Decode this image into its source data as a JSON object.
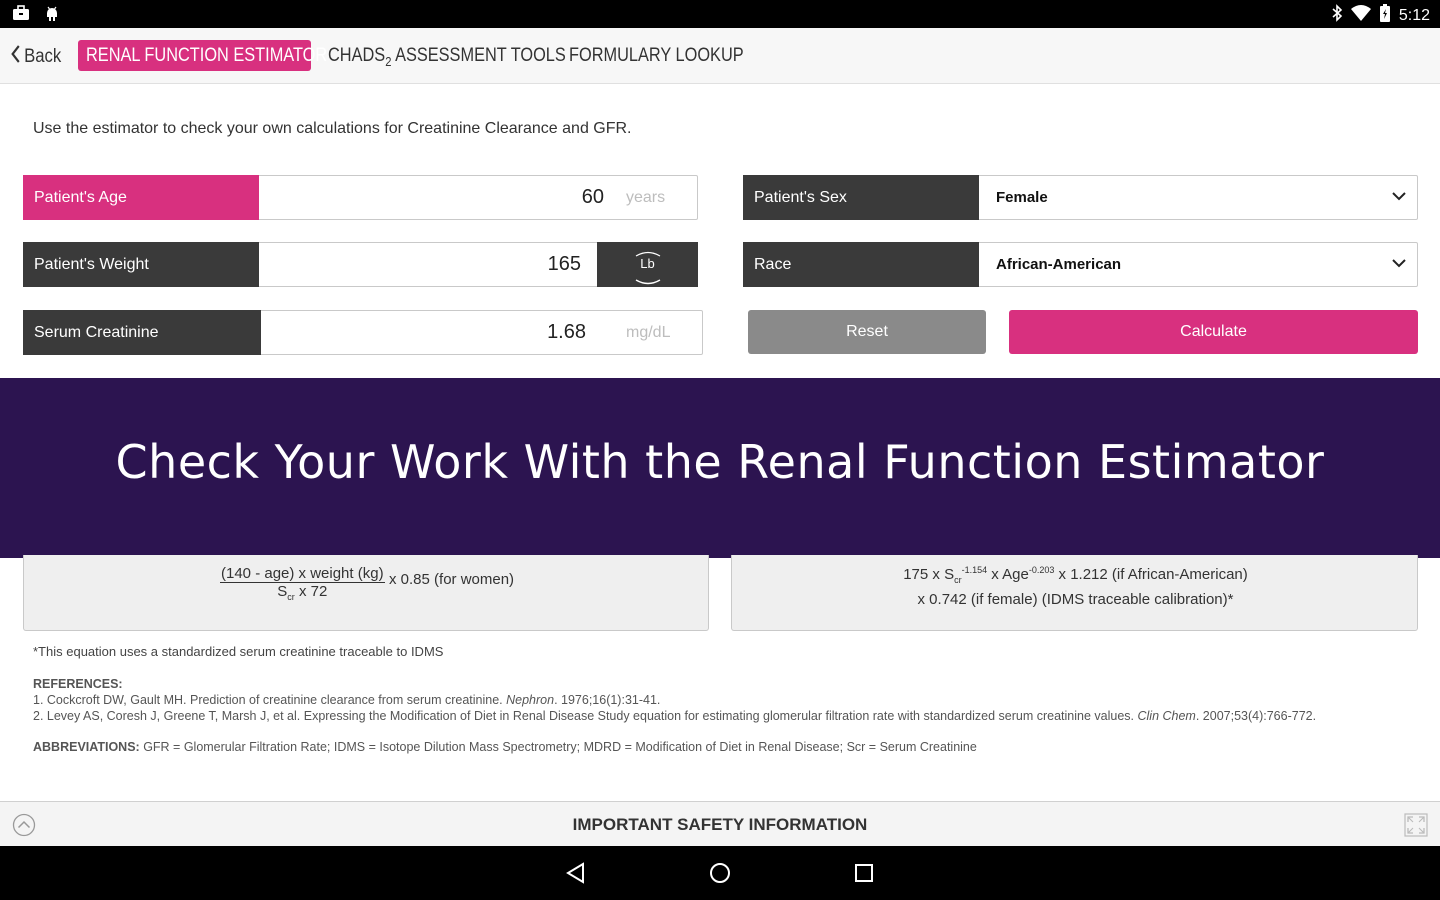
{
  "status_bar": {
    "time": "5:12",
    "left_icons": [
      "briefcase-icon",
      "android-icon"
    ],
    "right_icons": [
      "bluetooth-icon",
      "wifi-icon",
      "battery-icon"
    ]
  },
  "nav": {
    "back_label": "Back",
    "tabs": [
      {
        "label": "RENAL FUNCTION ESTIMATOR",
        "active": true
      },
      {
        "label": "CHADS",
        "subscript": "2",
        "label_rest": " ASSESSMENT TOOLS",
        "active": false
      },
      {
        "label": "FORMULARY LOOKUP",
        "active": false
      }
    ]
  },
  "intro": "Use the estimator to check your own calculations for Creatinine Clearance and GFR.",
  "form": {
    "age": {
      "label": "Patient's Age",
      "value": "60",
      "unit": "years"
    },
    "weight": {
      "label": "Patient's Weight",
      "value": "165",
      "unit": "Lb"
    },
    "creatinine": {
      "label": "Serum Creatinine",
      "value": "1.68",
      "unit": "mg/dL"
    },
    "sex": {
      "label": "Patient's Sex",
      "value": "Female"
    },
    "race": {
      "label": "Race",
      "value": "African-American"
    },
    "reset_label": "Reset",
    "calculate_label": "Calculate"
  },
  "banner": "Check Your Work With the Renal Function Estimator",
  "equations": {
    "cockcroft": {
      "numerator": "(140 - age) x weight (kg)",
      "denominator_pre": "S",
      "denominator_sub": "cr",
      "denominator_post": " x 72",
      "suffix": "x 0.85 (for women)"
    },
    "mdrd": {
      "line1_a": "175 x S",
      "line1_sub": "cr",
      "line1_sup": "-1.154",
      "line1_b": " x Age",
      "line1_sup2": "-0.203",
      "line1_c": " x 1.212 (if African-American)",
      "line2": "x 0.742 (if female) (IDMS traceable calibration)*"
    }
  },
  "footnote": "*This equation uses a standardized serum creatinine traceable to IDMS",
  "references": {
    "heading": "REFERENCES:",
    "ref1_a": "1. Cockcroft DW, Gault MH. Prediction of creatinine clearance from serum creatinine. ",
    "ref1_journal": "Nephron",
    "ref1_b": ". 1976;16(1):31-41.",
    "ref2_a": "2. Levey AS, Coresh J, Greene T, Marsh J, et al. Expressing the Modification of Diet in Renal Disease Study equation for estimating glomerular filtration rate with standardized serum creatinine values. ",
    "ref2_journal": "Clin Chem",
    "ref2_b": ". 2007;53(4):766-772."
  },
  "abbreviations": {
    "heading": "ABBREVIATIONS:",
    "text": " GFR = Glomerular Filtration Rate; IDMS = Isotope Dilution Mass Spectrometry; MDRD = Modification of Diet in Renal Disease; Scr = Serum Creatinine"
  },
  "safety_label": "IMPORTANT SAFETY INFORMATION",
  "colors": {
    "accent": "#d8307f",
    "dark": "#3a3a3a",
    "banner": "#2c1450",
    "reset": "#8a8a8a"
  }
}
